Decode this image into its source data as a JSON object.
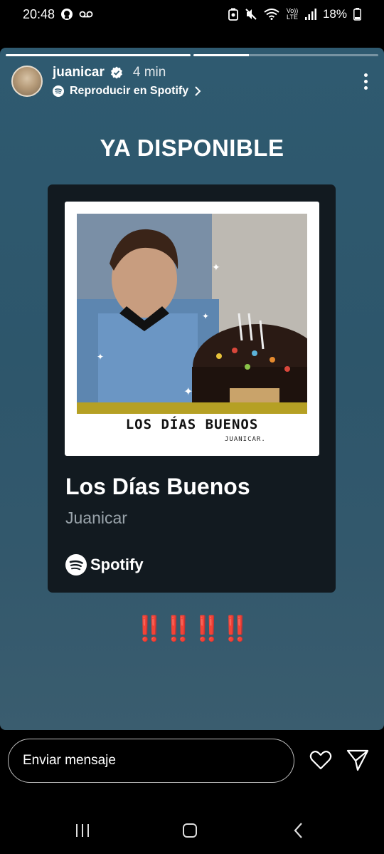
{
  "status_bar": {
    "time": "20:48",
    "battery": "18%",
    "network": "Vo)) LTE"
  },
  "story": {
    "progress": [
      1.0,
      0.3
    ],
    "username": "juanicar",
    "verified": true,
    "time_ago": "4 min",
    "subtitle": "Reproducir en Spotify",
    "headline": "YA DISPONIBLE",
    "card": {
      "cover_caption": "LOS DÍAS BUENOS",
      "cover_sub": "JUANICAR.",
      "title": "Los Días Buenos",
      "artist": "Juanicar",
      "brand": "Spotify"
    },
    "emphasis": "‼️‼️‼️‼️"
  },
  "reply": {
    "placeholder": "Enviar mensaje"
  },
  "icons": {
    "menu": "more-vertical-icon",
    "like": "heart-icon",
    "send": "send-icon",
    "nav_recents": "recents-icon",
    "nav_home": "home-icon",
    "nav_back": "back-icon"
  },
  "colors": {
    "story_bg": "#2f5a70",
    "card_bg": "#121a20",
    "artist_gray": "#9aa4ab",
    "bang_red": "#e0141b"
  }
}
